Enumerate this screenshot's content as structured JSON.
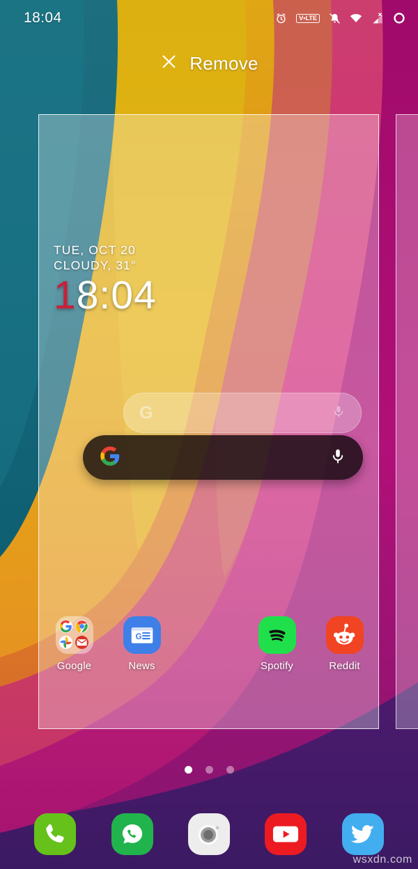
{
  "status_bar": {
    "time": "18:04",
    "icons": [
      {
        "name": "alarm-icon",
        "label": "Alarm"
      },
      {
        "name": "volte-icon",
        "label": "V•LTE"
      },
      {
        "name": "bell-muted-icon",
        "label": "Notifications muted"
      },
      {
        "name": "wifi-icon",
        "label": "Wi-Fi"
      },
      {
        "name": "signal-no-service-icon",
        "label": "No signal"
      },
      {
        "name": "battery-ring-icon",
        "label": "Battery"
      }
    ]
  },
  "remove_bar": {
    "label": "Remove",
    "icon": "close-x-icon"
  },
  "clock_widget": {
    "date": "TUE, OCT 20",
    "weather": "CLOUDY, 31°",
    "time_red": "1",
    "time_rest": "8:04"
  },
  "search_widget": {
    "google_icon": "google-g-icon",
    "mic_icon": "microphone-icon",
    "placeholder": ""
  },
  "app_grid": [
    {
      "label": "Google",
      "type": "folder",
      "icon": "google-folder-icon",
      "contents": [
        "Google",
        "Chrome",
        "Photos",
        "Gmail"
      ]
    },
    {
      "label": "News",
      "type": "app",
      "icon": "google-news-icon",
      "color": "#3F7FE8"
    },
    {
      "label": "",
      "type": "empty",
      "icon": ""
    },
    {
      "label": "Spotify",
      "type": "app",
      "icon": "spotify-icon",
      "color": "#1FE04A"
    },
    {
      "label": "Reddit",
      "type": "app",
      "icon": "reddit-icon",
      "color": "#F04422"
    }
  ],
  "page_dots": {
    "total": 3,
    "active_index": 0
  },
  "dock": [
    {
      "label": "Phone",
      "icon": "phone-icon",
      "color": "#66C21A"
    },
    {
      "label": "WhatsApp",
      "icon": "whatsapp-icon",
      "color": "#21B34C"
    },
    {
      "label": "Camera",
      "icon": "camera-icon",
      "color": "#EDEDED"
    },
    {
      "label": "YouTube",
      "icon": "youtube-icon",
      "color": "#EC1B22"
    },
    {
      "label": "Twitter",
      "icon": "twitter-icon",
      "color": "#42AEF0"
    }
  ],
  "watermark": "wsxdn.com",
  "colors": {
    "teal": "#176B7D",
    "yellow": "#D4AB07",
    "orange": "#E08520",
    "coral": "#C9573F",
    "pink": "#E8427F",
    "magenta": "#AC0F72",
    "purple": "#5B1C74",
    "navy": "#1C1A52",
    "accent_red": "#c9203a"
  }
}
